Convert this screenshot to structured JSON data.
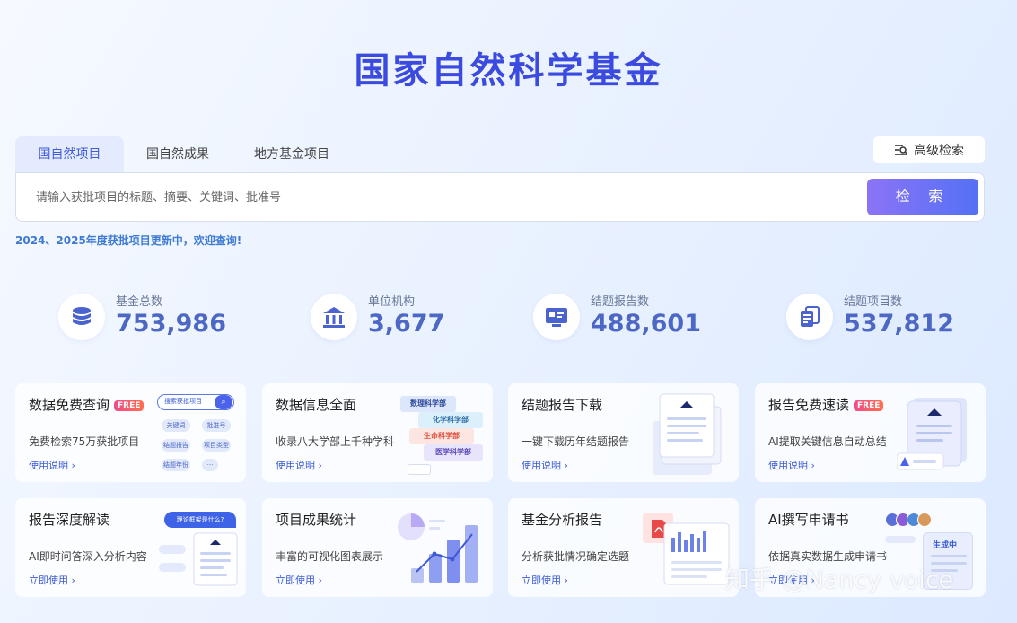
{
  "title": "国家自然科学基金",
  "tabs": [
    {
      "label": "国自然项目"
    },
    {
      "label": "国自然成果"
    },
    {
      "label": "地方基金项目"
    }
  ],
  "advanced_search": "高级检索",
  "search": {
    "placeholder": "请输入获批项目的标题、摘要、关键词、批准号",
    "button": "检 索"
  },
  "notice": "2024、2025年度获批项目更新中，欢迎查询!",
  "stats": [
    {
      "label": "基金总数",
      "value": "753,986",
      "icon": "database-icon"
    },
    {
      "label": "单位机构",
      "value": "3,677",
      "icon": "institution-icon"
    },
    {
      "label": "结题报告数",
      "value": "488,601",
      "icon": "report-icon"
    },
    {
      "label": "结题项目数",
      "value": "537,812",
      "icon": "documents-icon"
    }
  ],
  "free_badge": "FREE",
  "cards": [
    {
      "title": "数据免费查询",
      "free": true,
      "desc": "免费检索75万获批项目",
      "link": "使用说明",
      "art": {
        "search_label": "搜索获批项目",
        "tags": [
          "关键词",
          "批准号",
          "结题报告",
          "项目类型",
          "结题年份",
          "···"
        ]
      }
    },
    {
      "title": "数据信息全面",
      "free": false,
      "desc": "收录八大学部上千种学科",
      "link": "使用说明",
      "art": {
        "tags": [
          "数理科学部",
          "化学科学部",
          "生命科学部",
          "医学科学部"
        ]
      }
    },
    {
      "title": "结题报告下载",
      "free": false,
      "desc": "一键下载历年结题报告",
      "link": "使用说明"
    },
    {
      "title": "报告免费速读",
      "free": true,
      "desc": "AI提取关键信息自动总结",
      "link": "使用说明"
    },
    {
      "title": "报告深度解读",
      "free": false,
      "desc": "AI即时问答深入分析内容",
      "link": "立即使用",
      "art": {
        "bubble": "理论框架是什么?"
      }
    },
    {
      "title": "项目成果统计",
      "free": false,
      "desc": "丰富的可视化图表展示",
      "link": "立即使用"
    },
    {
      "title": "基金分析报告",
      "free": false,
      "desc": "分析获批情况确定选题",
      "link": "立即使用"
    },
    {
      "title": "AI撰写申请书",
      "free": false,
      "desc": "依据真实数据生成申请书",
      "link": "立即使用",
      "art": {
        "status": "生成中"
      }
    }
  ],
  "watermark": "知乎 @Nancy voice",
  "colors": {
    "brand": "#3b4be0",
    "accent": "#5471f5",
    "link": "#3a5bd6",
    "badge": "#f14b8a"
  }
}
